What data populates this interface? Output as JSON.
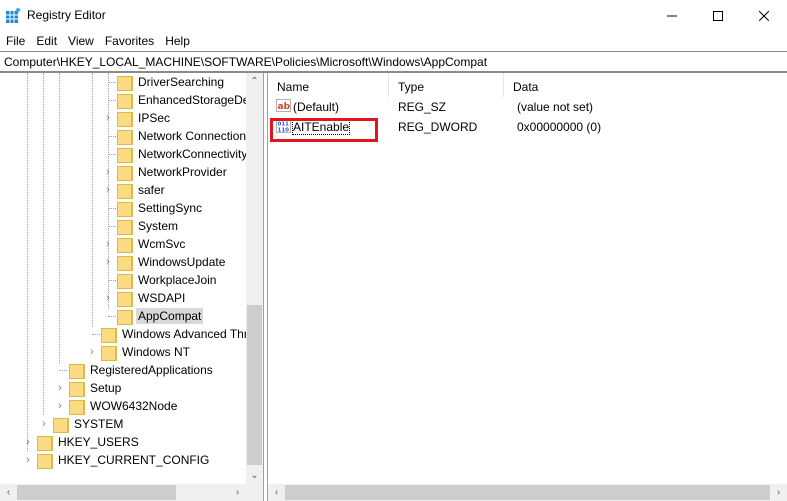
{
  "window": {
    "title": "Registry Editor",
    "controls": {
      "minimize": "minimize",
      "maximize": "maximize",
      "close": "close"
    }
  },
  "menu": [
    "File",
    "Edit",
    "View",
    "Favorites",
    "Help"
  ],
  "address": "Computer\\HKEY_LOCAL_MACHINE\\SOFTWARE\\Policies\\Microsoft\\Windows\\AppCompat",
  "tree": [
    {
      "label": "DriverSearching",
      "expandable": false,
      "selected": false
    },
    {
      "label": "EnhancedStorageDev",
      "expandable": false,
      "selected": false
    },
    {
      "label": "IPSec",
      "expandable": true,
      "selected": false
    },
    {
      "label": "Network Connection",
      "expandable": false,
      "selected": false
    },
    {
      "label": "NetworkConnectivity",
      "expandable": false,
      "selected": false
    },
    {
      "label": "NetworkProvider",
      "expandable": true,
      "selected": false
    },
    {
      "label": "safer",
      "expandable": true,
      "selected": false
    },
    {
      "label": "SettingSync",
      "expandable": false,
      "selected": false
    },
    {
      "label": "System",
      "expandable": false,
      "selected": false
    },
    {
      "label": "WcmSvc",
      "expandable": true,
      "selected": false
    },
    {
      "label": "WindowsUpdate",
      "expandable": true,
      "selected": false
    },
    {
      "label": "WorkplaceJoin",
      "expandable": false,
      "selected": false
    },
    {
      "label": "WSDAPI",
      "expandable": true,
      "selected": false
    },
    {
      "label": "AppCompat",
      "expandable": false,
      "selected": true
    },
    {
      "label": "Windows Advanced Thr",
      "expandable": false,
      "selected": false
    },
    {
      "label": "Windows NT",
      "expandable": true,
      "selected": false
    },
    {
      "label": "RegisteredApplications",
      "expandable": false,
      "selected": false
    },
    {
      "label": "Setup",
      "expandable": true,
      "selected": false
    },
    {
      "label": "WOW6432Node",
      "expandable": true,
      "selected": false
    },
    {
      "label": "SYSTEM",
      "expandable": true,
      "selected": false
    },
    {
      "label": "HKEY_USERS",
      "expandable": true,
      "selected": false
    },
    {
      "label": "HKEY_CURRENT_CONFIG",
      "expandable": true,
      "selected": false
    }
  ],
  "list": {
    "columns": [
      "Name",
      "Type",
      "Data"
    ],
    "rows": [
      {
        "icon": "string-value-icon",
        "name": "(Default)",
        "type": "REG_SZ",
        "data": "(value not set)"
      },
      {
        "icon": "binary-value-icon",
        "name": "AITEnable",
        "type": "REG_DWORD",
        "data": "0x00000000 (0)"
      }
    ]
  },
  "highlight": {
    "target": "AITEnable",
    "color": "#e0161c"
  },
  "scroll": {
    "tree_vertical_position": 0.62
  }
}
